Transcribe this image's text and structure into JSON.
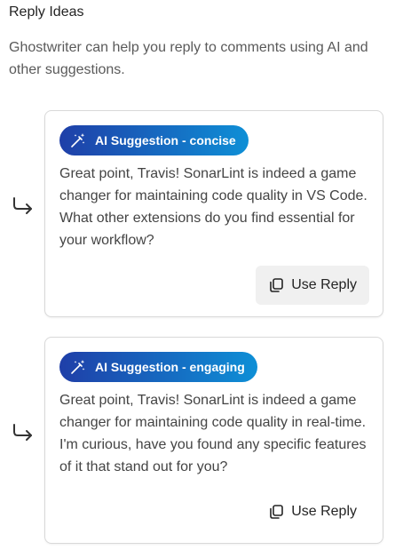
{
  "header": {
    "title": "Reply Ideas",
    "description": "Ghostwriter can help you reply to comments using AI and other suggestions."
  },
  "suggestions": [
    {
      "badge": "AI Suggestion - concise",
      "text": "Great point, Travis! SonarLint is indeed a game changer for maintaining code quality in VS Code. What other extensions do you find essential for your workflow?",
      "button_label": "Use Reply"
    },
    {
      "badge": "AI Suggestion - engaging",
      "text": "Great point, Travis! SonarLint is indeed a game changer for maintaining code quality in real-time. I'm curious, have you found any specific features of it that stand out for you?",
      "button_label": "Use Reply"
    }
  ],
  "colors": {
    "badge_gradient_start": "#1f3fa8",
    "badge_gradient_end": "#0e8fd6",
    "button_hover_bg": "#f0f0f0"
  },
  "icons": {
    "reply_arrow": "reply-arrow-icon",
    "magic_wand": "magic-wand-icon",
    "copy": "copy-icon"
  }
}
